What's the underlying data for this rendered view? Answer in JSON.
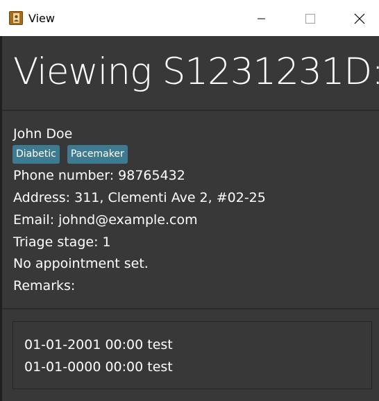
{
  "window": {
    "title": "View",
    "app_icon": "contact-book-icon",
    "controls": [
      "minimize-icon",
      "maximize-icon",
      "close-icon"
    ]
  },
  "header": {
    "title": "Viewing S1231231D:"
  },
  "person": {
    "name": "John Doe",
    "tags": [
      "Diabetic",
      "Pacemaker"
    ],
    "phone": "Phone number: 98765432",
    "address": "Address: 311, Clementi Ave 2, #02-25",
    "email": "Email: johnd@example.com",
    "triage": "Triage stage: 1",
    "appointment": "No appointment set.",
    "remarks": "Remarks:"
  },
  "appointments": [
    "01-01-2001 00:00 test",
    "01-01-0000 00:00 test"
  ],
  "colors": {
    "background": "#383838",
    "tag": "#3e7b91",
    "titlebar": "#ffffff",
    "text": "#ffffff"
  }
}
